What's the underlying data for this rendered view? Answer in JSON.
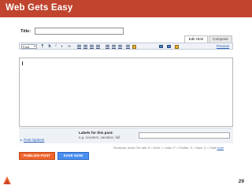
{
  "slide": {
    "title": "Web Gets Easy",
    "page_number": "29"
  },
  "post": {
    "title_label": "Title:",
    "title_value": ""
  },
  "tabs": [
    {
      "label": "Edit Html"
    },
    {
      "label": "Compose"
    }
  ],
  "toolbar": {
    "font_value": "Font",
    "bold_glyph": "b",
    "italic_glyph": "i",
    "preview_label": "Preview"
  },
  "editor": {
    "body_value": ""
  },
  "options": {
    "post_options_label": "Post Options",
    "labels_title": "Labels for this post:",
    "labels_hint": "e.g. scooters, vacation, fall",
    "labels_value": "",
    "shortcuts_text": "Shortcuts: press Ctrl with: B = Bold, I = Italic, P = Publish, S = Save, D = Draft",
    "shortcuts_more": "more"
  },
  "actions": {
    "publish_label": "PUBLISH POST",
    "save_label": "SAVE NOW"
  },
  "colors": {
    "banner": "#c0442e",
    "publish": "#f0642d",
    "save": "#4a8ff0",
    "link": "#2d62b8"
  }
}
